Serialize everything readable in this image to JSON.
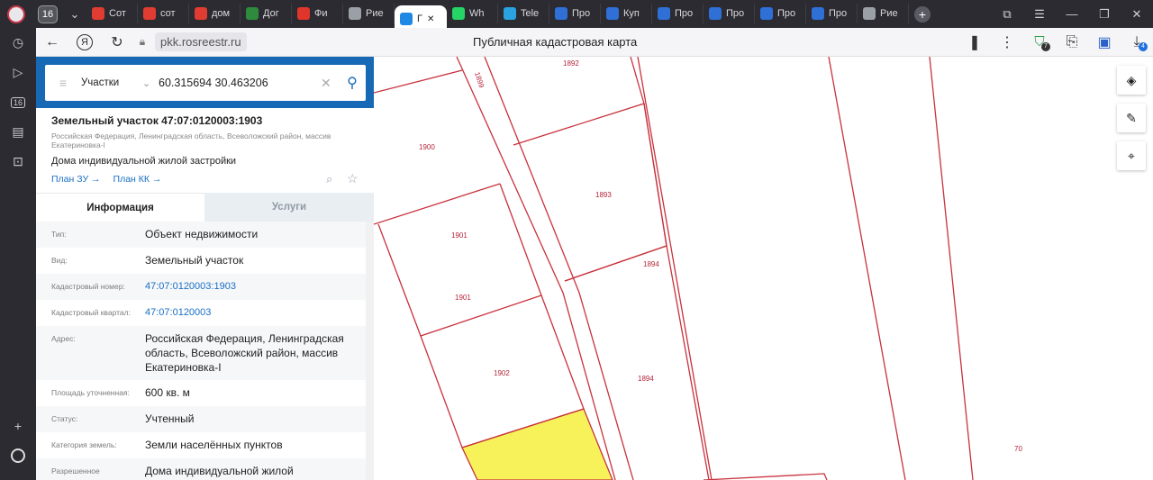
{
  "browser": {
    "tab_counter": "16",
    "tabs": [
      {
        "label": "Сот",
        "color": "#e03c31"
      },
      {
        "label": "сот",
        "color": "#e03c31"
      },
      {
        "label": "дом",
        "color": "#e03c31"
      },
      {
        "label": "Дог",
        "color": "#2e8b3d"
      },
      {
        "label": "Фи",
        "color": "#e0352b"
      },
      {
        "label": "Рие",
        "color": "#9aa0a6"
      },
      {
        "label": "Г",
        "color": "#1e88e5",
        "active": true
      },
      {
        "label": "Wh",
        "color": "#25d366"
      },
      {
        "label": "Tele",
        "color": "#2aa3e0"
      },
      {
        "label": "Про",
        "color": "#2f6fd6"
      },
      {
        "label": "Куп",
        "color": "#2f6fd6"
      },
      {
        "label": "Про",
        "color": "#2f6fd6"
      },
      {
        "label": "Про",
        "color": "#2f6fd6"
      },
      {
        "label": "Про",
        "color": "#2f6fd6"
      },
      {
        "label": "Про",
        "color": "#2f6fd6"
      },
      {
        "label": "Рие",
        "color": "#9aa0a6"
      }
    ],
    "url": "pkk.rosreestr.ru",
    "page_title": "Публичная кадастровая карта",
    "rail_badge": "16",
    "ext_badge": "7",
    "download_badge": "4"
  },
  "search": {
    "mode": "Участки",
    "query": "60.315694 30.463206"
  },
  "object": {
    "title": "Земельный участок 47:07:0120003:1903",
    "address_small": "Российская Федерация, Ленинградская область, Всеволожский район, массив Екатериновка-I",
    "use_type": "Дома индивидуальной жилой застройки",
    "link_plan_zu": "План ЗУ",
    "link_plan_kk": "План КК"
  },
  "tabs": {
    "info": "Информация",
    "services": "Услуги"
  },
  "info_rows": [
    {
      "label": "Тип:",
      "value": "Объект недвижимости"
    },
    {
      "label": "Вид:",
      "value": "Земельный участок"
    },
    {
      "label": "Кадастровый номер:",
      "value": "47:07:0120003:1903",
      "link": true
    },
    {
      "label": "Кадастровый квартал:",
      "value": "47:07:0120003",
      "link": true
    },
    {
      "label": "Адрес:",
      "value": "Российская Федерация, Ленинградская область, Всеволожский район, массив Екатериновка-I"
    },
    {
      "label": "Площадь уточненная:",
      "value": "600 кв. м"
    },
    {
      "label": "Статус:",
      "value": "Учтенный"
    },
    {
      "label": "Категория земель:",
      "value": "Земли населённых пунктов"
    },
    {
      "label": "Разрешенное",
      "value": "Дома индивидуальной жилой"
    }
  ],
  "map": {
    "parcel_labels": [
      "1892",
      "1899",
      "1900",
      "1893",
      "1901",
      "1894",
      "1901",
      "1902",
      "1894",
      "70"
    ],
    "selected_fill": "#f7f25a",
    "line_color": "#c8323c"
  }
}
